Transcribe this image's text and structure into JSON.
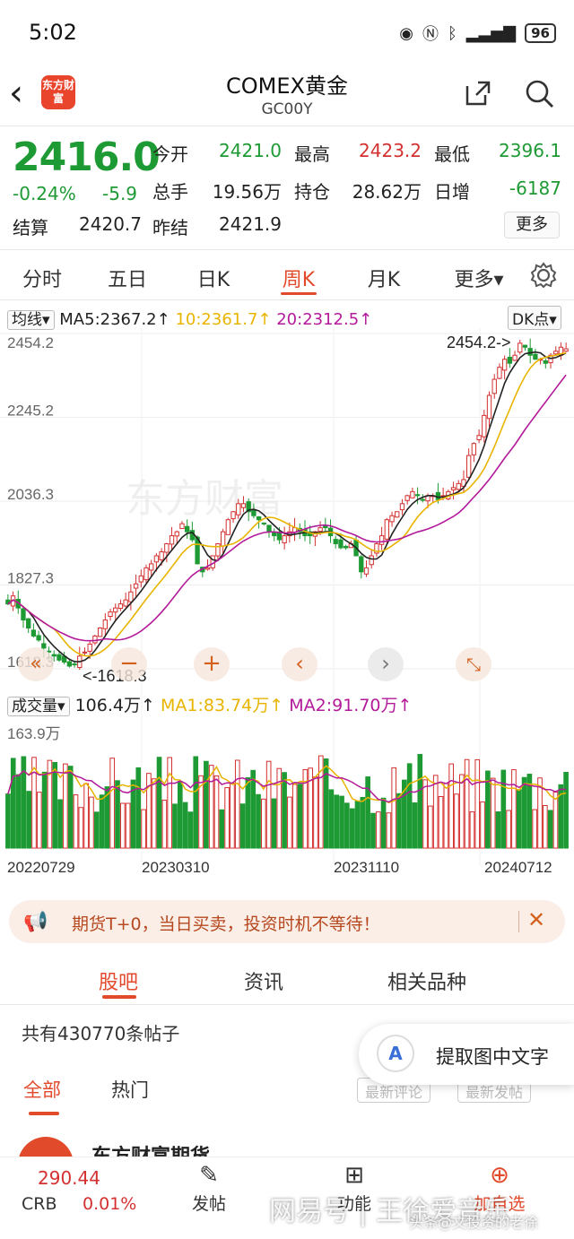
{
  "status": {
    "time": "5:02",
    "battery": "96"
  },
  "header": {
    "title": "COMEX黄金",
    "code": "GC00Y",
    "logo_text": "东方财富"
  },
  "quote": {
    "price": "2416.0",
    "change_pct": "-0.24%",
    "change": "-5.9",
    "open_label": "今开",
    "open": "2421.0",
    "high_label": "最高",
    "high": "2423.2",
    "low_label": "最低",
    "low": "2396.1",
    "volume_label": "总手",
    "volume": "19.56万",
    "oi_label": "持仓",
    "oi": "28.62万",
    "daily_inc_label": "日增",
    "daily_inc": "-6187",
    "settle_label": "结算",
    "settle": "2420.7",
    "prev_settle_label": "昨结",
    "prev_settle": "2421.9",
    "more_label": "更多"
  },
  "tabs": [
    "分时",
    "五日",
    "日K",
    "周K",
    "月K",
    "更多▾"
  ],
  "active_tab": "周K",
  "ma_bar": {
    "selector": "均线▾",
    "ma5": "MA5:2367.2↑",
    "ma10": "10:2361.7↑",
    "ma20": "20:2312.5↑",
    "dk": "DK点▾"
  },
  "chart_data": [
    {
      "type": "candlestick",
      "title": "",
      "y_ticks": [
        "2454.2",
        "2245.2",
        "2036.3",
        "1827.3",
        "1618.3"
      ],
      "ylim": [
        1618.3,
        2454.2
      ],
      "max_marker": "2454.2->",
      "min_marker": "<-1618.3",
      "colors": {
        "up": "#d43030",
        "down": "#1e9a34",
        "ma5": "#222222",
        "ma10": "#e8b400",
        "ma20": "#b31a9a"
      },
      "series_close": [
        1780,
        1800,
        1770,
        1740,
        1720,
        1700,
        1690,
        1670,
        1660,
        1650,
        1640,
        1635,
        1625,
        1630,
        1650,
        1660,
        1680,
        1700,
        1720,
        1740,
        1760,
        1770,
        1780,
        1790,
        1810,
        1830,
        1850,
        1870,
        1880,
        1900,
        1910,
        1930,
        1950,
        1960,
        1980,
        1960,
        1940,
        1880,
        1860,
        1870,
        1900,
        1930,
        1960,
        1990,
        2010,
        2030,
        2030,
        2010,
        2000,
        1990,
        1980,
        1960,
        1950,
        1940,
        1950,
        1960,
        1970,
        1960,
        1950,
        1950,
        1960,
        1970,
        1970,
        1950,
        1930,
        1920,
        1920,
        1930,
        1900,
        1860,
        1870,
        1900,
        1930,
        1950,
        1990,
        2000,
        2010,
        2030,
        2050,
        2060,
        2050,
        2040,
        2050,
        2050,
        2040,
        2050,
        2060,
        2070,
        2080,
        2090,
        2150,
        2180,
        2200,
        2250,
        2300,
        2340,
        2370,
        2390,
        2380,
        2400,
        2430,
        2420,
        2400,
        2390,
        2390,
        2380,
        2400,
        2410,
        2420,
        2416
      ],
      "volume_bars_count": 108,
      "date_labels": [
        "20220729",
        "20230310",
        "20231110",
        "20240712"
      ]
    }
  ],
  "volume_bar": {
    "selector": "成交量▾",
    "value": "106.4万↑",
    "ma1": "MA1:83.74万↑",
    "ma2": "MA2:91.70万↑",
    "max_tick": "163.9万"
  },
  "banner": {
    "text": "期货T+0，当日买卖，投资时机不等待！"
  },
  "section_tabs": [
    "股吧",
    "资讯",
    "相关品种"
  ],
  "posts": {
    "count_text": "共有430770条帖子",
    "filters": [
      "全部",
      "热门"
    ],
    "sort1": "最新评论",
    "sort2": "最新发帖",
    "feed_title": "东方财富期货"
  },
  "float_ocr": {
    "label": "提取图中文字",
    "icon": "A"
  },
  "bottom": {
    "crb_value": "290.44",
    "crb_name": "CRB",
    "crb_pct": "0.01%",
    "post_label": "发帖",
    "func_label": "功能",
    "add_label": "加自选"
  },
  "watermark": {
    "line1": "网易号 | 王徐爱音乐",
    "line2": "头条@文投资的老徐"
  }
}
